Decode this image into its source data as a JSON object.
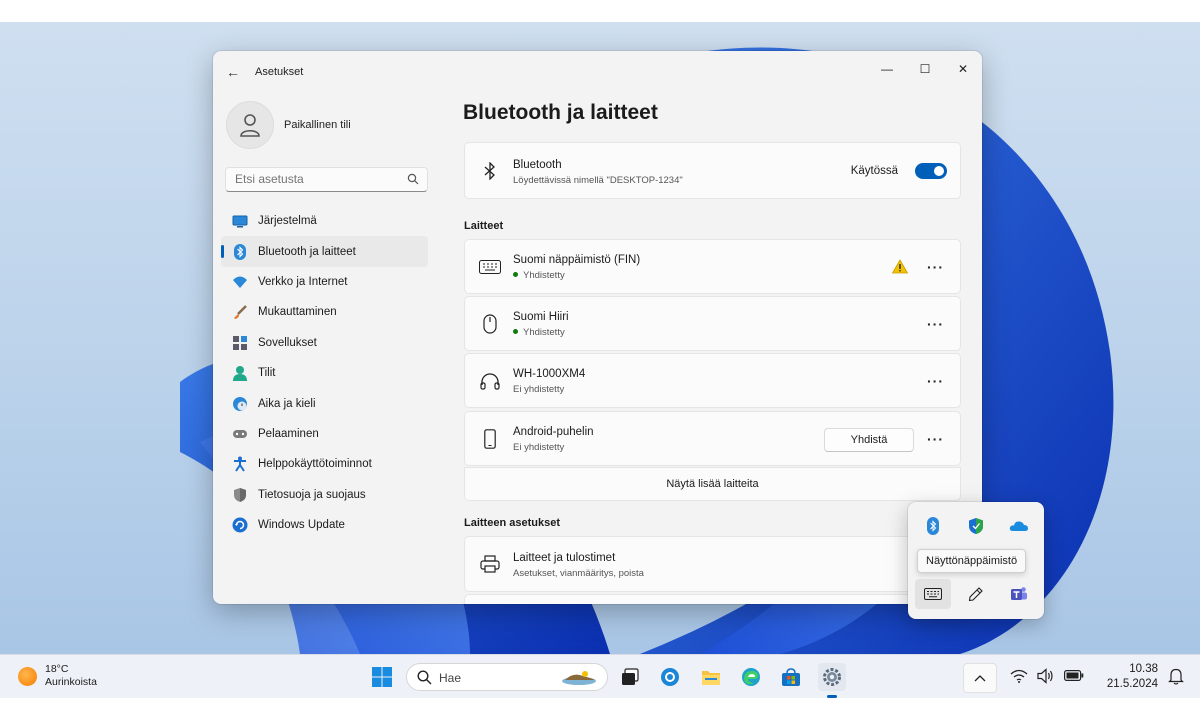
{
  "window": {
    "title": "Asetukset",
    "controls": {
      "minimize": "—",
      "maximize": "☐",
      "close": "✕"
    }
  },
  "sidebar": {
    "profile_name": "Paikallinen tili",
    "search_placeholder": "Etsi asetusta",
    "items": [
      {
        "label": "Järjestelmä",
        "icon": "system-icon"
      },
      {
        "label": "Bluetooth ja laitteet",
        "icon": "bluetooth-icon",
        "active": true
      },
      {
        "label": "Verkko ja Internet",
        "icon": "wifi-icon"
      },
      {
        "label": "Mukauttaminen",
        "icon": "brush-icon"
      },
      {
        "label": "Sovellukset",
        "icon": "apps-icon"
      },
      {
        "label": "Tilit",
        "icon": "person-icon"
      },
      {
        "label": "Aika ja kieli",
        "icon": "globe-clock-icon"
      },
      {
        "label": "Pelaaminen",
        "icon": "gamepad-icon"
      },
      {
        "label": "Helppokäyttötoiminnot",
        "icon": "accessibility-icon"
      },
      {
        "label": "Tietosuoja ja suojaus",
        "icon": "shield-icon"
      },
      {
        "label": "Windows Update",
        "icon": "update-icon"
      }
    ]
  },
  "main": {
    "title": "Bluetooth ja laitteet",
    "bluetooth": {
      "title": "Bluetooth",
      "subtitle": "Löydettävissä nimellä \"DESKTOP-1234\"",
      "toggle_label": "Käytössä",
      "enabled": true
    },
    "devices_header": "Laitteet",
    "devices": [
      {
        "name": "Suomi näppäimistö (FIN)",
        "status": "Yhdistetty",
        "connected": true,
        "icon": "keyboard-icon",
        "warning": true
      },
      {
        "name": "Suomi Hiiri",
        "status": "Yhdistetty",
        "connected": true,
        "icon": "mouse-icon"
      },
      {
        "name": "WH-1000XM4",
        "status": "Ei yhdistetty",
        "connected": false,
        "icon": "headphones-icon"
      },
      {
        "name": "Android-puhelin",
        "status": "Ei yhdistetty",
        "connected": false,
        "icon": "phone-icon",
        "action": "Yhdistä"
      }
    ],
    "more_options": "···",
    "show_more": "Näytä lisää laitteita",
    "device_settings_header": "Laitteen asetukset",
    "printers": {
      "title": "Laitteet ja tulostimet",
      "subtitle": "Asetukset, vianmääritys, poista"
    }
  },
  "tray_flyout": {
    "icons": [
      "bluetooth-icon",
      "defender-icon",
      "onedrive-icon",
      "keyboard-icon",
      "pen-icon",
      "teams-icon"
    ],
    "tooltip": "Näyttönäppäimistö"
  },
  "taskbar": {
    "weather_temp": "18°C",
    "weather_desc": "Aurinkoista",
    "search_label": "Hae",
    "time": "10.38",
    "date": "21.5.2024"
  },
  "colors": {
    "accent": "#005fb8",
    "connected_dot": "#0f7b0f",
    "warning": "#f2c200"
  }
}
